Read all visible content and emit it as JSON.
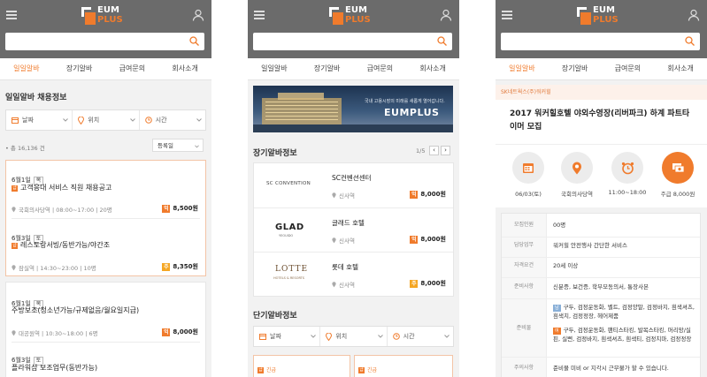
{
  "brand": {
    "name_top": "EUM",
    "name_bottom": "PLUS"
  },
  "nav": [
    "일일알바",
    "장기알바",
    "급여문의",
    "회사소개"
  ],
  "filters": {
    "date": "날짜",
    "location": "위치",
    "time": "시간"
  },
  "screen1": {
    "title": "일일알바 채용정보",
    "count": "• 총 16,136 건",
    "sort": "등록일",
    "jobs": [
      {
        "date": "6월1일",
        "day": "목",
        "title": "고객응대 서비스 직원 채용공고",
        "urgent": true,
        "loc": "국회의사당역",
        "time": "08:00~17:00",
        "people": "20명",
        "pay_type": "익",
        "pay": "8,500원"
      },
      {
        "date": "6월3일",
        "day": "토",
        "title": "레스토랑서빙/동반가능/야간조",
        "urgent": true,
        "loc": "잠실역",
        "time": "14:30~23:00",
        "people": "10명",
        "pay_type": "주",
        "pay": "8,350원"
      },
      {
        "date": "6월1일",
        "day": "목",
        "title": "주방보조(청소년가능/규제없음/월요일지급)",
        "urgent": false,
        "loc": "대공원역",
        "time": "10:30~18:00",
        "people": "6명",
        "pay_type": "익",
        "pay": "8,000원"
      },
      {
        "date": "6월3일",
        "day": "토",
        "title": "플라워샵 보조업무(동반가능)",
        "urgent": false
      }
    ]
  },
  "screen2": {
    "banner_caption": "국내 고용시장의 미래를 새롭게 열어갑니다.",
    "banner_brand": "EUMPLUS",
    "long_title": "장기알바정보",
    "page": "1/5",
    "companies": [
      {
        "logo": "SC CONVENTION",
        "name": "SC컨벤션센터",
        "loc": "신사역",
        "pay_type": "익",
        "pay": "8,000원"
      },
      {
        "logo": "GLAD",
        "logo_sub": "YEOUIDO",
        "name": "글래드 호텔",
        "loc": "신사역",
        "pay_type": "익",
        "pay": "8,000원"
      },
      {
        "logo": "LOTTE",
        "logo_sub": "HOTELS & RESORTS",
        "name": "롯데 호텔",
        "loc": "신사역",
        "pay_type": "주",
        "pay": "8,000원"
      }
    ],
    "short_title": "단기알바정보",
    "urgent_label": "긴급"
  },
  "screen3": {
    "company": "SK네트웍스(주)워커힐",
    "title": "2017 워커힐호텔 야외수영장(리버파크) 하계 파트타이머 모집",
    "summary": [
      {
        "icon": "calendar-icon",
        "label": "06/03(토)"
      },
      {
        "icon": "location-icon",
        "label": "국회의사당역"
      },
      {
        "icon": "alarm-icon",
        "label": "11:00~18:00"
      },
      {
        "icon": "money-icon",
        "label": "주급 8,000원"
      }
    ],
    "details": [
      {
        "key": "모집인원",
        "value": "00명"
      },
      {
        "key": "담당업무",
        "value": "워커힐 안전행사 간단한 서비스"
      },
      {
        "key": "자격요건",
        "value": "20세 이상"
      },
      {
        "key": "준비사항",
        "value": "신분증, 보건증, 학부모동의서, 통장사본"
      },
      {
        "key": "준비물",
        "tag1": "남",
        "value1": "구두, 검정운동화, 벨트, 검정양말, 검정바지, 흰색셔츠, 흰색치, 검정정장, 헤어제품",
        "tag2": "여",
        "value2": "구두, 검정운동화, 팬티스타킹, 발목스타킹, 머리망/실핀, 실삔, 검정바지, 흰색셔츠, 흰색티, 검정치마, 검정정장"
      },
      {
        "key": "주의사항",
        "value": "준비물 미비 or 지각시 근무불가 할 수 있습니다."
      }
    ]
  }
}
